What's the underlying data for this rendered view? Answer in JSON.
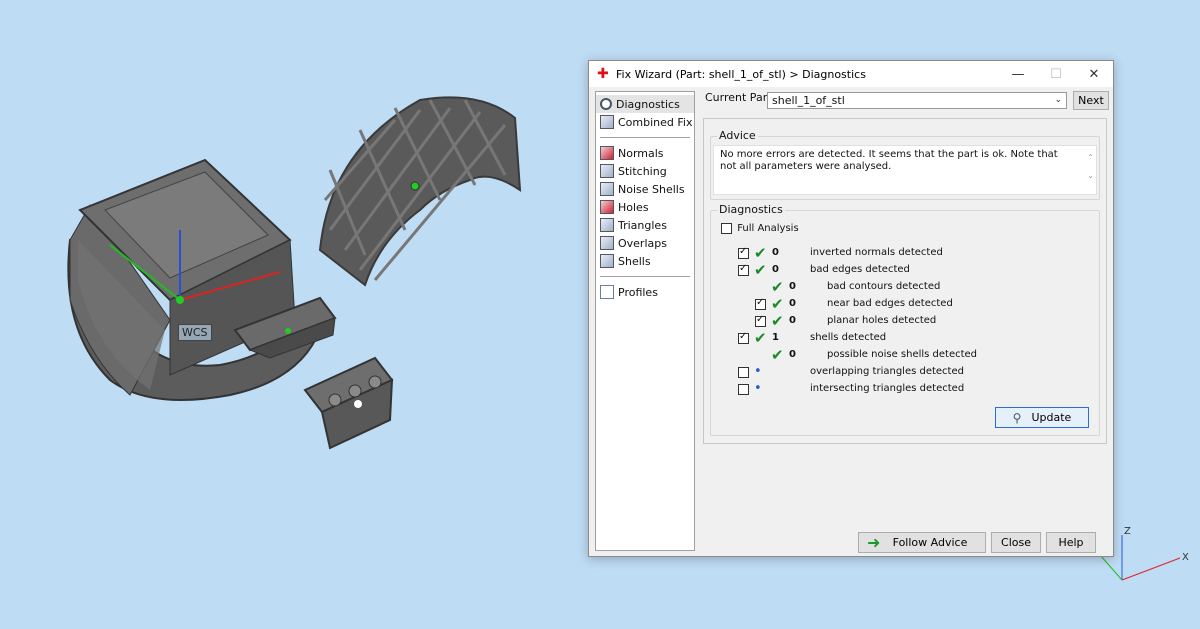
{
  "viewport": {
    "wcs_label": "WCS"
  },
  "dialog": {
    "title": "Fix Wizard (Part: shell_1_of_stl) > Diagnostics",
    "window_buttons": {
      "minimize": "—",
      "maximize": "☐",
      "close": "✕"
    }
  },
  "sidebar": {
    "items": [
      {
        "label": "Diagnostics",
        "icon": "search-icon"
      },
      {
        "label": "Combined Fix",
        "icon": "cube-icon"
      },
      {
        "label": "Normals",
        "icon": "cube-icon"
      },
      {
        "label": "Stitching",
        "icon": "cube-icon"
      },
      {
        "label": "Noise Shells",
        "icon": "cube-icon"
      },
      {
        "label": "Holes",
        "icon": "cube-icon"
      },
      {
        "label": "Triangles",
        "icon": "cube-icon"
      },
      {
        "label": "Overlaps",
        "icon": "cube-icon"
      },
      {
        "label": "Shells",
        "icon": "cube-icon"
      },
      {
        "label": "Profiles",
        "icon": "document-icon"
      }
    ]
  },
  "current_part": {
    "label": "Current Part:",
    "value": "shell_1_of_stl",
    "next_button": "Next"
  },
  "advice": {
    "title": "Advice",
    "text": "No more errors are detected. It seems that the part is ok. Note that not all parameters were analysed."
  },
  "diagnostics": {
    "title": "Diagnostics",
    "full_analysis_label": "Full Analysis",
    "full_analysis_checked": false,
    "rows": [
      {
        "label": "inverted normals detected",
        "count": "0",
        "checked": true,
        "status": "ok",
        "indent": 0
      },
      {
        "label": "bad edges detected",
        "count": "0",
        "checked": true,
        "status": "ok",
        "indent": 0
      },
      {
        "label": "bad contours detected",
        "count": "0",
        "checked": null,
        "status": "ok",
        "indent": 1
      },
      {
        "label": "near bad edges detected",
        "count": "0",
        "checked": true,
        "status": "ok",
        "indent": 1
      },
      {
        "label": "planar holes detected",
        "count": "0",
        "checked": true,
        "status": "ok",
        "indent": 1
      },
      {
        "label": "shells detected",
        "count": "1",
        "checked": true,
        "status": "ok",
        "indent": 0
      },
      {
        "label": "possible noise shells detected",
        "count": "0",
        "checked": null,
        "status": "ok",
        "indent": 1
      },
      {
        "label": "overlapping triangles detected",
        "count": "",
        "checked": false,
        "status": "pending",
        "indent": 0
      },
      {
        "label": "intersecting triangles detected",
        "count": "",
        "checked": false,
        "status": "pending",
        "indent": 0
      }
    ],
    "update_button": "Update"
  },
  "footer": {
    "follow_advice": "Follow Advice",
    "close": "Close",
    "help": "Help"
  },
  "axes_indicator": {
    "z_label": "Z",
    "x_label": "X"
  },
  "colors": {
    "background": "#bfdcf5",
    "ok_check": "#1a8a2a",
    "accent": "#2a5bd0"
  }
}
